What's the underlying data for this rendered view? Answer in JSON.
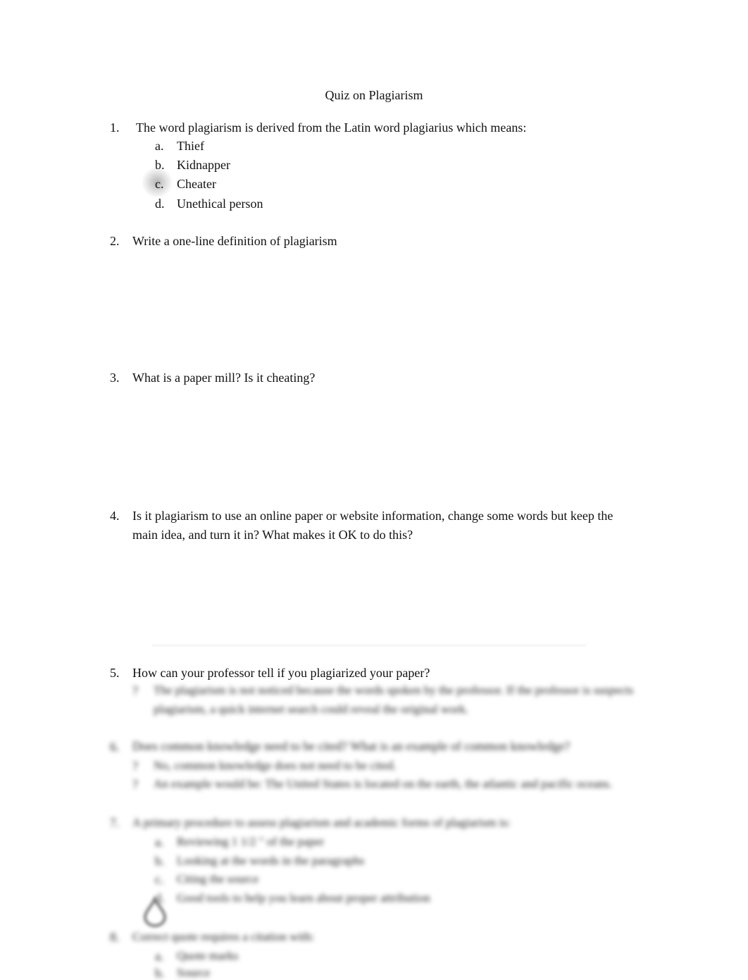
{
  "document": {
    "title": "Quiz on Plagiarism",
    "questions": [
      {
        "number": "1.",
        "text": "The word plagiarism is derived from the Latin word plagiarius which means:",
        "options": [
          {
            "letter": "a.",
            "text": "Thief"
          },
          {
            "letter": "b.",
            "text": "Kidnapper"
          },
          {
            "letter": "c.",
            "text": "Cheater"
          },
          {
            "letter": "d.",
            "text": "Unethical person"
          }
        ]
      },
      {
        "number": "2.",
        "text": "Write a one-line definition of plagiarism"
      },
      {
        "number": "3.",
        "text": "What is a paper mill?  Is it cheating?"
      },
      {
        "number": "4.",
        "text_line1": "Is it plagiarism to use an online paper or website information, change some words but keep the",
        "text_line2": "main idea, and turn it in?   What makes it OK to do this?"
      },
      {
        "number": "5.",
        "text": "How can your professor tell if you plagiarized your paper?",
        "blurred_answer": {
          "bullet": "?",
          "line1": "The plagiarism is not noticed because the words spoken by the professor. If the professor is suspects",
          "line2": "plagiarism, a quick internet search could reveal the original work."
        }
      }
    ],
    "blurred_section": {
      "q6": {
        "number": "6.",
        "text": "Does common knowledge need to be cited?  What is an example of common knowledge?",
        "bullets": [
          "No, common knowledge does not need to be cited.",
          "An example would be: The United States is located on the earth, the atlantic and pacific oceans."
        ]
      },
      "q7": {
        "number": "7.",
        "text": "A primary procedure to assess plagiarism and academic forms of plagiarism is:",
        "options": [
          {
            "letter": "a.",
            "text": "Reviewing 1 1/2 \" of the paper"
          },
          {
            "letter": "b.",
            "text": "Looking at the words in the paragraphs"
          },
          {
            "letter": "c.",
            "text": "Citing the source"
          },
          {
            "letter": "d.",
            "text": "Good tools to help you learn about proper attribution"
          }
        ]
      },
      "q8": {
        "number": "8.",
        "text": "Correct quote requires a citation with:",
        "options": [
          {
            "letter": "a.",
            "text": "Quote marks"
          },
          {
            "letter": "b.",
            "text": "Source"
          }
        ]
      }
    }
  }
}
